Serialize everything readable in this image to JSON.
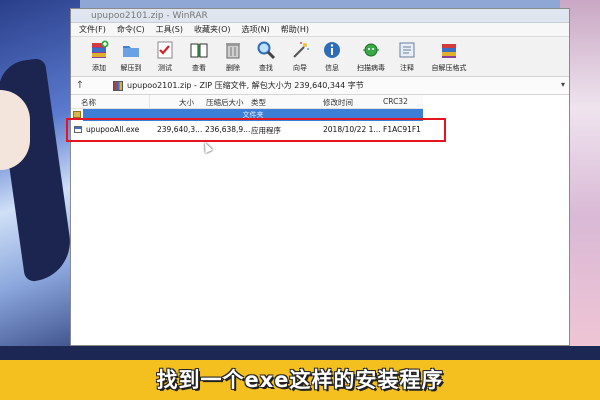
{
  "window": {
    "title": "upupoo2101.zip - WinRAR"
  },
  "menu": [
    "文件(F)",
    "命令(C)",
    "工具(S)",
    "收藏夹(O)",
    "选项(N)",
    "帮助(H)"
  ],
  "toolbar": [
    {
      "label": "添加",
      "icon": "add-archive-icon"
    },
    {
      "label": "解压到",
      "icon": "extract-folder-icon"
    },
    {
      "label": "测试",
      "icon": "test-checklist-icon"
    },
    {
      "label": "查看",
      "icon": "view-book-icon"
    },
    {
      "label": "删除",
      "icon": "trash-icon"
    },
    {
      "label": "查找",
      "icon": "magnifier-icon"
    },
    {
      "label": "向导",
      "icon": "wizard-wand-icon"
    },
    {
      "label": "信息",
      "icon": "info-icon"
    },
    {
      "label": "扫描病毒",
      "icon": "virus-scan-icon"
    },
    {
      "label": "注释",
      "icon": "comment-icon"
    },
    {
      "label": "自解压格式",
      "icon": "sfx-icon"
    }
  ],
  "address": {
    "path": "upupoo2101.zip - ZIP 压缩文件, 解包大小为 239,640,344 字节"
  },
  "columns": [
    "名称",
    "大小",
    "压缩后大小",
    "类型",
    "修改时间",
    "CRC32"
  ],
  "up_row": {
    "label": "文件夹"
  },
  "files": [
    {
      "name": "upupooAll.exe",
      "size": "239,640,3...",
      "packed": "236,638,9...",
      "type": "应用程序",
      "modified": "2018/10/22 1...",
      "crc": "F1AC91F1"
    }
  ],
  "caption": "找到一个exe这样的安装程序",
  "colors": {
    "highlight": "#e5141f",
    "selection": "#3d7fd6",
    "caption_bg": "#f4c020"
  }
}
